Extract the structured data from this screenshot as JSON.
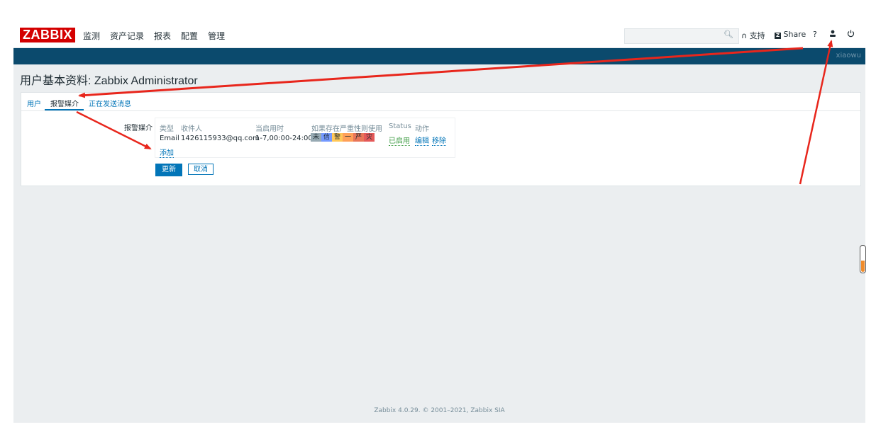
{
  "header": {
    "logo": "ZABBIX",
    "menu": [
      "监测",
      "资产记录",
      "报表",
      "配置",
      "管理"
    ],
    "search": {
      "value": "",
      "placeholder": ""
    },
    "support_label": "支持",
    "share_label": "Share",
    "help_label": "?",
    "username": "xiaowu"
  },
  "page": {
    "title": "用户基本资料: Zabbix Administrator"
  },
  "tabs": [
    {
      "label": "用户",
      "active": false
    },
    {
      "label": "报警媒介",
      "active": true
    },
    {
      "label": "正在发送消息",
      "active": false
    }
  ],
  "media": {
    "field_label": "报警媒介",
    "columns": [
      "类型",
      "收件人",
      "当启用时",
      "如果存在严重性则使用",
      "Status",
      "动作"
    ],
    "row": {
      "type": "Email",
      "send_to": "1426115933@qq.com",
      "when_active": "1-7,00:00-24:00",
      "severities": [
        {
          "label": "未",
          "color": "#97aab3"
        },
        {
          "label": "信",
          "color": "#7499ff"
        },
        {
          "label": "警",
          "color": "#ffc859"
        },
        {
          "label": "一",
          "color": "#ffa059"
        },
        {
          "label": "严",
          "color": "#e97659"
        },
        {
          "label": "灾",
          "color": "#e45959"
        }
      ],
      "status": "已启用",
      "action_edit": "编辑",
      "action_remove": "移除"
    },
    "add_label": "添加"
  },
  "buttons": {
    "update": "更新",
    "cancel": "取消"
  },
  "footer": {
    "text": "Zabbix 4.0.29. © 2001–2021, Zabbix SIA"
  },
  "colors": {
    "brand": "#d40000",
    "header_bar": "#0b4a6d",
    "link": "#0275b8",
    "annotation_arrow": "#e8261c"
  }
}
